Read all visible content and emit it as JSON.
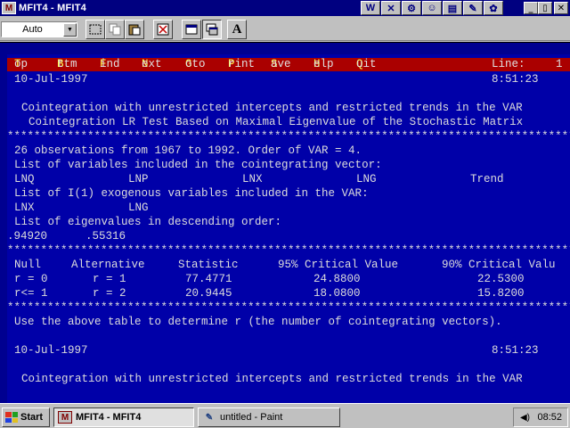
{
  "window": {
    "title": "MFIT4 - MFIT4",
    "app_icon_glyph": "M",
    "toolbar_icons": [
      "w-icon",
      "x-icon",
      "cog-icon",
      "user-icon",
      "save-icon",
      "tools-icon",
      "flower-icon"
    ],
    "minimize": "_",
    "maximize": "▯",
    "close": "✕"
  },
  "toolbar": {
    "font_size": "Auto",
    "bold_glyph": "A"
  },
  "menu": {
    "items": [
      {
        "hotkey": "T",
        "rest": "op"
      },
      {
        "hotkey": "B",
        "rest": "ttm"
      },
      {
        "hotkey": "F",
        "rest": "ind"
      },
      {
        "hotkey": "N",
        "rest": "ext"
      },
      {
        "hotkey": "G",
        "rest": "oto"
      },
      {
        "hotkey": "P",
        "rest": "rint"
      },
      {
        "hotkey": "S",
        "rest": "ave"
      },
      {
        "hotkey": "H",
        "rest": "elp"
      },
      {
        "hotkey": "Q",
        "rest": "uit"
      }
    ],
    "line_label": "Line:",
    "line_value": "1"
  },
  "report": {
    "date": "10-Jul-1997",
    "time": "8:51:23",
    "heading1": "Cointegration with unrestricted intercepts and restricted trends in the VAR",
    "heading2": "Cointegration LR Test Based on Maximal Eigenvalue of the Stochastic Matrix",
    "stars": "****************************************************************************************",
    "obs_line": "26 observations from 1967 to 1992. Order of VAR = 4.",
    "vars_label": "List of variables included in the cointegrating vector:",
    "vars": [
      "LNQ",
      "LNP",
      "LNX",
      "LNG",
      "Trend"
    ],
    "exog_label": "List of I(1) exogenous variables included in the VAR:",
    "exog": [
      "LNX",
      "LNG"
    ],
    "eigen_label": "List of eigenvalues in descending order:",
    "eigen": [
      ".94920",
      ".55316"
    ],
    "table": {
      "headers": [
        "Null",
        "Alternative",
        "Statistic",
        "95% Critical Value",
        "90% Critical Valu"
      ],
      "rows": [
        [
          "r = 0",
          "r = 1",
          "77.4771",
          "24.8800",
          "22.5300"
        ],
        [
          "r<= 1",
          "r = 2",
          "20.9445",
          "18.0800",
          "15.8200"
        ]
      ]
    },
    "note": "Use the above table to determine r (the number of cointegrating vectors).",
    "date2": "10-Jul-1997",
    "time2": "8:51:23",
    "heading3": "Cointegration with unrestricted intercepts and restricted trends in the VAR"
  },
  "taskbar": {
    "start": "Start",
    "tasks": [
      {
        "label": "MFIT4 - MFIT4",
        "icon": "mfit-icon"
      },
      {
        "label": "untitled - Paint",
        "icon": "paint-icon"
      }
    ],
    "clock": "08:52"
  }
}
